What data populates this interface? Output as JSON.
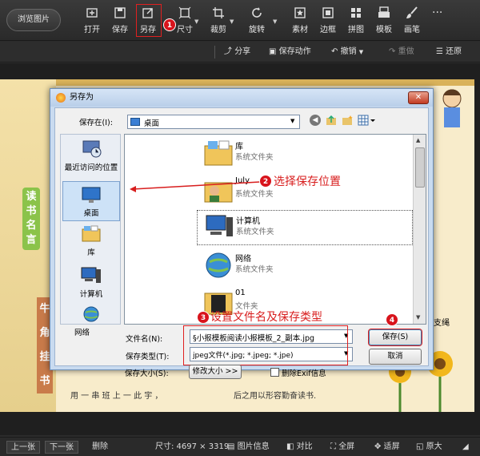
{
  "toolbar": {
    "browse_label": "浏览图片",
    "items": [
      {
        "label": "打开",
        "icon": "open-icon"
      },
      {
        "label": "保存",
        "icon": "save-icon"
      },
      {
        "label": "另存",
        "icon": "save-as-icon"
      },
      {
        "label": "尺寸",
        "icon": "resize-icon"
      },
      {
        "label": "裁剪",
        "icon": "crop-icon"
      },
      {
        "label": "旋转",
        "icon": "rotate-icon"
      },
      {
        "label": "素材",
        "icon": "material-icon"
      },
      {
        "label": "边框",
        "icon": "border-icon"
      },
      {
        "label": "拼图",
        "icon": "collage-icon"
      },
      {
        "label": "模板",
        "icon": "template-icon"
      },
      {
        "label": "画笔",
        "icon": "brush-icon"
      }
    ],
    "more": "···"
  },
  "toolbar2": {
    "share": "分享",
    "save_action": "保存动作",
    "undo": "撤销",
    "redo": "重做",
    "restore": "还原"
  },
  "badges": {
    "one": "1",
    "two": "2",
    "three": "3",
    "four": "4"
  },
  "annotations": {
    "select_location": "选择保存位置",
    "set_name_type": "设置文件名及保存类型"
  },
  "dialog": {
    "title": "另存为",
    "save_in_label": "保存在(I):",
    "save_in_value": "桌面",
    "nav": [
      {
        "label": "最近访问的位置",
        "icon": "recent-places-icon"
      },
      {
        "label": "桌面",
        "icon": "desktop-icon"
      },
      {
        "label": "库",
        "icon": "library-icon"
      },
      {
        "label": "计算机",
        "icon": "computer-icon"
      },
      {
        "label": "网络",
        "icon": "network-icon"
      }
    ],
    "files": [
      {
        "name": "库",
        "type": "系统文件夹",
        "icon": "library-folder-icon"
      },
      {
        "name": "July",
        "type": "系统文件夹",
        "icon": "user-folder-icon"
      },
      {
        "name": "计算机",
        "type": "系统文件夹",
        "icon": "computer-icon"
      },
      {
        "name": "网络",
        "type": "系统文件夹",
        "icon": "network-icon"
      },
      {
        "name": "01",
        "type": "文件夹",
        "icon": "folder-icon"
      }
    ],
    "filename_label": "文件名(N):",
    "filename_value": "§小报模板阅读小报模板_2_副本.jpg",
    "filetype_label": "保存类型(T):",
    "filetype_value": "jpeg文件(*.jpg; *.jpeg; *.jpe)",
    "size_label": "保存大小(S):",
    "resize_button": "修改大小 >>",
    "exif_label": "删除Exif信息",
    "save_button": "保存(S)",
    "cancel_button": "取消"
  },
  "poster": {
    "vertical_text": [
      "读",
      "书",
      "名",
      "言"
    ],
    "side_chars": [
      "牛",
      "角",
      "挂",
      "书"
    ],
    "bottom_left": "用 一 串 班 上 一 此 宇 ，",
    "bottom_right": "后之用以形容勤奋读书.",
    "right_edge": "支绳"
  },
  "statusbar": {
    "prev": "上一张",
    "next": "下一张",
    "delete": "删除",
    "size": "尺寸: 4697 × 3319",
    "info": "图片信息",
    "compare": "对比",
    "fullscreen": "全屏",
    "fit": "适屏",
    "original": "原大"
  }
}
